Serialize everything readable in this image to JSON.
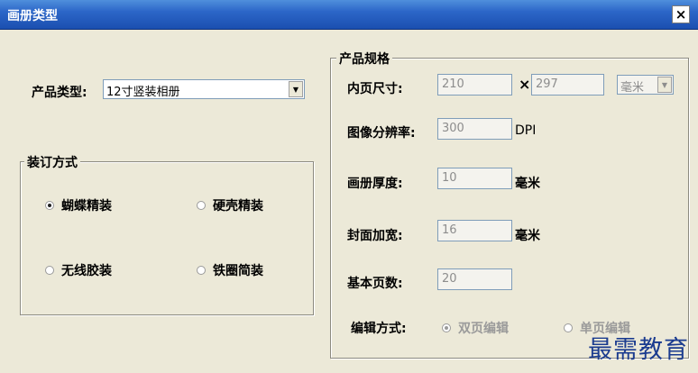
{
  "window": {
    "title": "画册类型",
    "close_glyph": "×"
  },
  "product_type": {
    "label": "产品类型:",
    "value": "12寸竖装相册",
    "dropdown_icon": "chevron-down-icon"
  },
  "binding": {
    "legend": "装订方式",
    "options": [
      {
        "label": "蝴蝶精装",
        "selected": true
      },
      {
        "label": "硬壳精装",
        "selected": false
      },
      {
        "label": "无线胶装",
        "selected": false
      },
      {
        "label": "铁圈简装",
        "selected": false
      }
    ]
  },
  "spec": {
    "legend": "产品规格",
    "inner_size": {
      "label": "内页尺寸:",
      "width": "210",
      "times": "×",
      "height": "297",
      "unit": "毫米"
    },
    "resolution": {
      "label": "图像分辨率:",
      "value": "300",
      "unit": "DPI"
    },
    "thickness": {
      "label": "画册厚度:",
      "value": "10",
      "unit": "毫米"
    },
    "cover_widen": {
      "label": "封面加宽:",
      "value": "16",
      "unit": "毫米"
    },
    "base_pages": {
      "label": "基本页数:",
      "value": "20"
    },
    "edit_mode": {
      "label": "编辑方式:",
      "options": [
        {
          "label": "双页编辑",
          "selected": true
        },
        {
          "label": "单页编辑",
          "selected": false
        }
      ]
    }
  },
  "watermark": "最需教育"
}
